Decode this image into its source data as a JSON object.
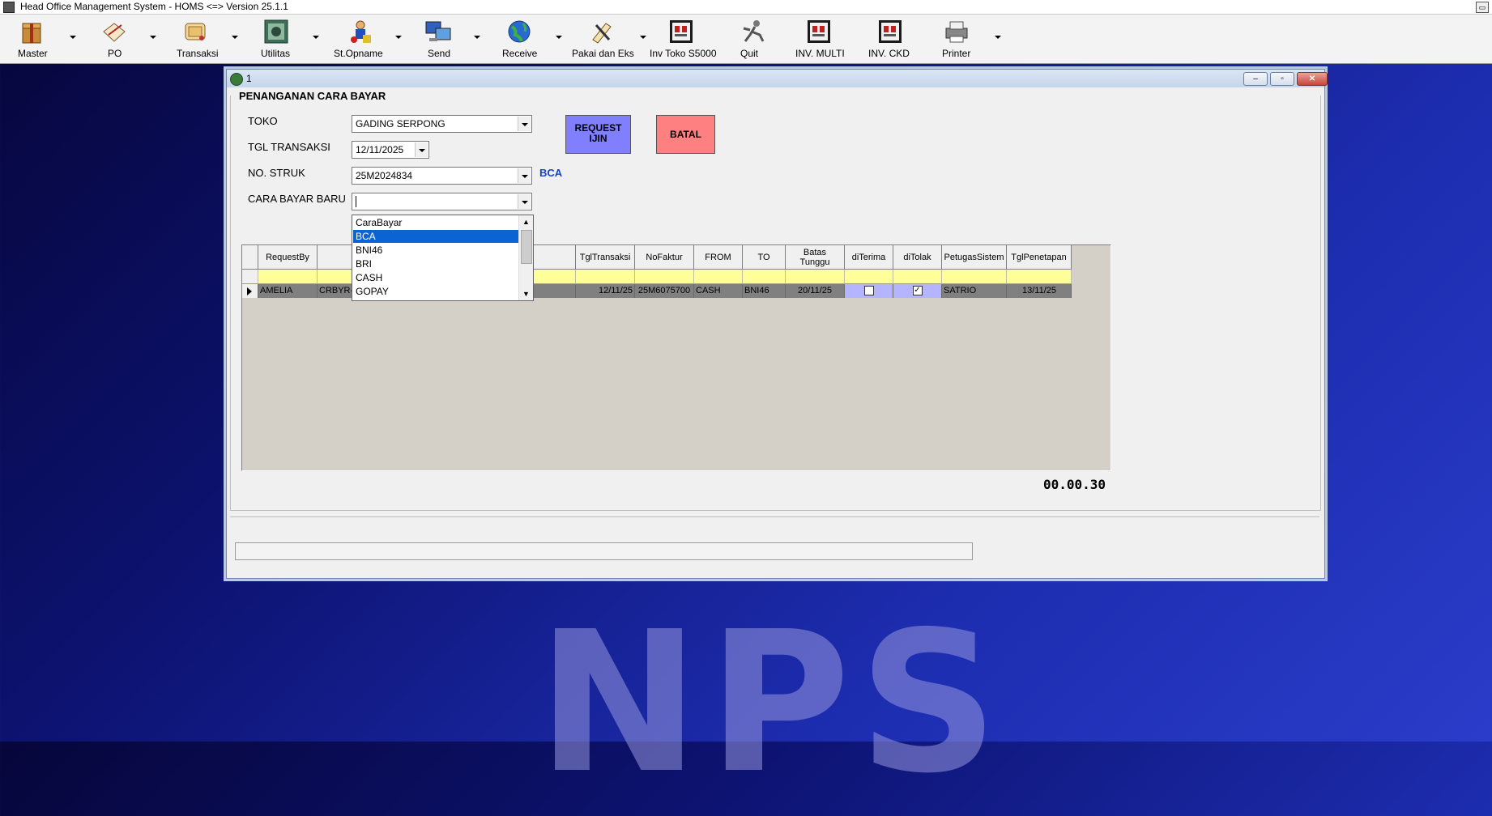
{
  "app": {
    "title": "Head Office Management System - HOMS <=> Version 25.1.1"
  },
  "toolbar": {
    "items": [
      {
        "label": "Master",
        "icon": "package-icon"
      },
      {
        "label": "PO",
        "icon": "pen-paper-icon"
      },
      {
        "label": "Transaksi",
        "icon": "scroll-icon"
      },
      {
        "label": "Utilitas",
        "icon": "money-icon"
      },
      {
        "label": "St.Opname",
        "icon": "worker-icon"
      },
      {
        "label": "Send",
        "icon": "computer-send-icon"
      },
      {
        "label": "Receive",
        "icon": "globe-icon"
      },
      {
        "label": "Pakai dan Eks",
        "icon": "tools-icon"
      },
      {
        "label": "Inv Toko S5000",
        "icon": "invoice-icon"
      },
      {
        "label": "Quit",
        "icon": "runner-icon"
      },
      {
        "label": "INV. MULTI",
        "icon": "invoice-icon"
      },
      {
        "label": "INV. CKD",
        "icon": "invoice-icon"
      },
      {
        "label": "Printer",
        "icon": "printer-icon"
      }
    ]
  },
  "window": {
    "title": "1",
    "minimize": "–",
    "restore": "▫",
    "close": "✕"
  },
  "form": {
    "group_title": "PENANGANAN CARA BAYAR",
    "toko_label": "TOKO",
    "toko_value": "GADING SERPONG",
    "tgl_label": "TGL TRANSAKSI",
    "tgl_value": "12/11/2025",
    "struk_label": "NO. STRUK",
    "struk_value": "25M2024834",
    "struk_payment": "BCA",
    "cara_bayar_label": "CARA BAYAR BARU",
    "cara_bayar_value": "",
    "request_button": "REQUEST IJIN",
    "batal_button": "BATAL"
  },
  "dropdown": {
    "header": "CaraBayar",
    "items": [
      "BCA",
      "BNI46",
      "BRI",
      "CASH",
      "GOPAY"
    ],
    "selected": "BCA"
  },
  "grid": {
    "columns": [
      "RequestBy",
      "",
      "",
      "TglTransaksi",
      "NoFaktur",
      "FROM",
      "TO",
      "Batas Tunggu",
      "diTerima",
      "diTolak",
      "PetugasSistem",
      "TglPenetapan"
    ],
    "row": {
      "request_by": "AMELIA",
      "code": "CRBYR-2",
      "tgl_transaksi": "12/11/25",
      "no_faktur": "25M6075700",
      "from": "CASH",
      "to": "BNI46",
      "batas_tunggu": "20/11/25",
      "diterima": false,
      "ditolak": true,
      "petugas": "SATRIO",
      "tgl_penetapan": "13/11/25"
    }
  },
  "timer": "00.00.30",
  "background_logo": "NPS",
  "colors": {
    "request_button": "#8080ff",
    "batal_button": "#ff8080",
    "filter_row": "#ffff99",
    "selected_item": "#0a64d2"
  }
}
